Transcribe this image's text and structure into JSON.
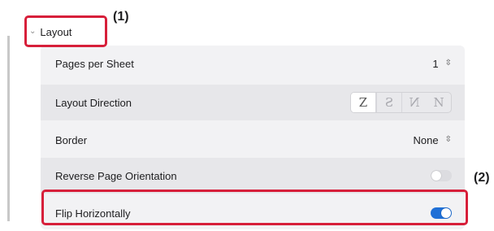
{
  "section": {
    "title": "Layout",
    "chevron_icon": "chevron-down-icon",
    "expanded": true
  },
  "rows": {
    "pages_per_sheet": {
      "label": "Pages per Sheet",
      "value": "1"
    },
    "layout_direction": {
      "label": "Layout Direction",
      "options": [
        "Z",
        "S",
        "N",
        "N"
      ],
      "selected_index": 0
    },
    "border": {
      "label": "Border",
      "value": "None"
    },
    "reverse_page_orientation": {
      "label": "Reverse Page Orientation",
      "on": false
    },
    "flip_horizontally": {
      "label": "Flip Horizontally",
      "on": true
    }
  },
  "callouts": {
    "one": "(1)",
    "two": "(2)"
  },
  "colors": {
    "callout_red": "#d71f3a",
    "toggle_on": "#1f6fd6",
    "panel_bg": "#f2f2f4"
  }
}
